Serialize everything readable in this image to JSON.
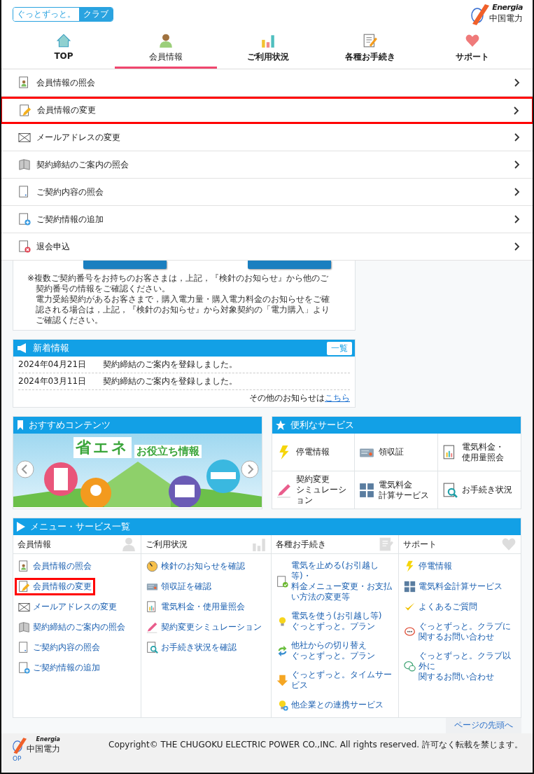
{
  "header": {
    "club_logo": {
      "text": "ぐっとずっと。",
      "badge": "クラブ"
    },
    "corp_logo": {
      "brand": "Energia",
      "name": "中国電力"
    }
  },
  "nav": [
    {
      "label": "TOP",
      "kind": "house",
      "selected": false
    },
    {
      "label": "会員情報",
      "kind": "person",
      "selected": true
    },
    {
      "label": "ご利用状況",
      "kind": "bar-chart",
      "selected": false
    },
    {
      "label": "各種お手続き",
      "kind": "notepad-pencil",
      "selected": false
    },
    {
      "label": "サポート",
      "kind": "heart",
      "selected": false
    }
  ],
  "dropdown": [
    {
      "label": "会員情報の照会",
      "kind": "person-document",
      "highlighted": false
    },
    {
      "label": "会員情報の変更",
      "kind": "pencil-document",
      "highlighted": true
    },
    {
      "label": "メールアドレスの変更",
      "kind": "envelope",
      "highlighted": false
    },
    {
      "label": "契約締結のご案内の照会",
      "kind": "book",
      "highlighted": false
    },
    {
      "label": "ご契約内容の照会",
      "kind": "document",
      "highlighted": false
    },
    {
      "label": "ご契約情報の追加",
      "kind": "document-plus",
      "highlighted": false
    },
    {
      "label": "退会申込",
      "kind": "document-cross",
      "highlighted": false
    }
  ],
  "notice": [
    "※複数ご契約番号をお持ちのお客さまは，上記，『検針のお知らせ』から他のご契約番号の情報をご確認ください。",
    "電力受給契約があるお客さまで，購入電力量・購入電力料金のお知らせをご確認される場合は，上記，『検針のお知らせ』から対象契約の「電力購入」よりご確認ください。"
  ],
  "news": {
    "title": "新着情報",
    "list_button": "一覧",
    "items": [
      {
        "date": "2024年04月21日",
        "text": "契約締結のご案内を登録しました。"
      },
      {
        "date": "2024年03月11日",
        "text": "契約締結のご案内を登録しました。"
      }
    ],
    "more_text": "その他のお知らせは",
    "more_link": "こちら"
  },
  "recommend": {
    "title": "おすすめコンテンツ",
    "banner_title": "省エネ",
    "banner_subtitle": "お役立ち情報"
  },
  "services": {
    "title": "便利なサービス",
    "items": [
      {
        "lines": [
          "停電情報"
        ],
        "kind": "lightning"
      },
      {
        "lines": [
          "領収証"
        ],
        "kind": "receipt"
      },
      {
        "lines": [
          "電気料金・",
          "使用量照会"
        ],
        "kind": "chart-document"
      },
      {
        "lines": [
          "契約変更",
          "シミュレーション"
        ],
        "kind": "pencil"
      },
      {
        "lines": [
          "電気料金",
          "計算サービス"
        ],
        "kind": "calculator"
      },
      {
        "lines": [
          "お手続き状況"
        ],
        "kind": "magnifier-document"
      }
    ]
  },
  "menu": {
    "title": "メニュー・サービス一覧",
    "columns": [
      {
        "heading": "会員情報",
        "kind": "person",
        "items": [
          {
            "lines": [
              "会員情報の照会"
            ],
            "kind": "person-document",
            "highlighted": false
          },
          {
            "lines": [
              "会員情報の変更"
            ],
            "kind": "pencil-document",
            "highlighted": true
          },
          {
            "lines": [
              "メールアドレスの変更"
            ],
            "kind": "envelope",
            "highlighted": false
          },
          {
            "lines": [
              "契約締結のご案内の照会"
            ],
            "kind": "book",
            "highlighted": false
          },
          {
            "lines": [
              "ご契約内容の照会"
            ],
            "kind": "document",
            "highlighted": false
          },
          {
            "lines": [
              "ご契約情報の追加"
            ],
            "kind": "document-plus",
            "highlighted": false
          }
        ]
      },
      {
        "heading": "ご利用状況",
        "kind": "bar-chart",
        "items": [
          {
            "lines": [
              "検針のお知らせを確認"
            ],
            "kind": "gauge",
            "highlighted": false
          },
          {
            "lines": [
              "領収証を確認"
            ],
            "kind": "receipt",
            "highlighted": false
          },
          {
            "lines": [
              "電気料金・使用量照会"
            ],
            "kind": "chart-document",
            "highlighted": false
          },
          {
            "lines": [
              "契約変更シミュレーション"
            ],
            "kind": "pencil",
            "highlighted": false
          },
          {
            "lines": [
              "お手続き状況を確認"
            ],
            "kind": "magnifier-document",
            "highlighted": false
          }
        ]
      },
      {
        "heading": "各種お手続き",
        "kind": "notepad-pencil",
        "items": [
          {
            "lines": [
              "電気を止める(お引越し等)・",
              "料金メニュー変更・お支払い方法の変更等"
            ],
            "kind": "document-check",
            "highlighted": false
          },
          {
            "lines": [
              "電気を使う(お引越し等)",
              "ぐっとずっと。プラン"
            ],
            "kind": "lightbulb",
            "highlighted": false
          },
          {
            "lines": [
              "他社からの切り替え",
              "ぐっとずっと。プラン"
            ],
            "kind": "refresh-arrows",
            "highlighted": false
          },
          {
            "lines": [
              "ぐっとずっと。タイムサービス"
            ],
            "kind": "down-arrow",
            "highlighted": false
          },
          {
            "lines": [
              "他企業との連携サービス"
            ],
            "kind": "lightbulb-plus",
            "highlighted": false
          }
        ]
      },
      {
        "heading": "サポート",
        "kind": "heart",
        "items": [
          {
            "lines": [
              "停電情報"
            ],
            "kind": "lightning",
            "highlighted": false
          },
          {
            "lines": [
              "電気料金計算サービス"
            ],
            "kind": "calculator",
            "highlighted": false
          },
          {
            "lines": [
              "よくあるご質問"
            ],
            "kind": "checkmark",
            "highlighted": false
          },
          {
            "lines": [
              "ぐっとずっと。クラブに",
              "関するお問い合わせ"
            ],
            "kind": "speech-bubble",
            "highlighted": false
          },
          {
            "lines": [
              "ぐっとずっと。クラブ以外に",
              "関するお問い合わせ"
            ],
            "kind": "question-bubble",
            "highlighted": false
          }
        ]
      }
    ]
  },
  "footer": {
    "page_top": "ページの先頭へ",
    "copyright": "Copyright© THE CHUGOKU ELECTRIC POWER CO.,INC. All rights reserved. 許可なく転載を禁じます。",
    "logo_brand": "Energia",
    "logo_name": "中国電力",
    "op": "OP"
  }
}
